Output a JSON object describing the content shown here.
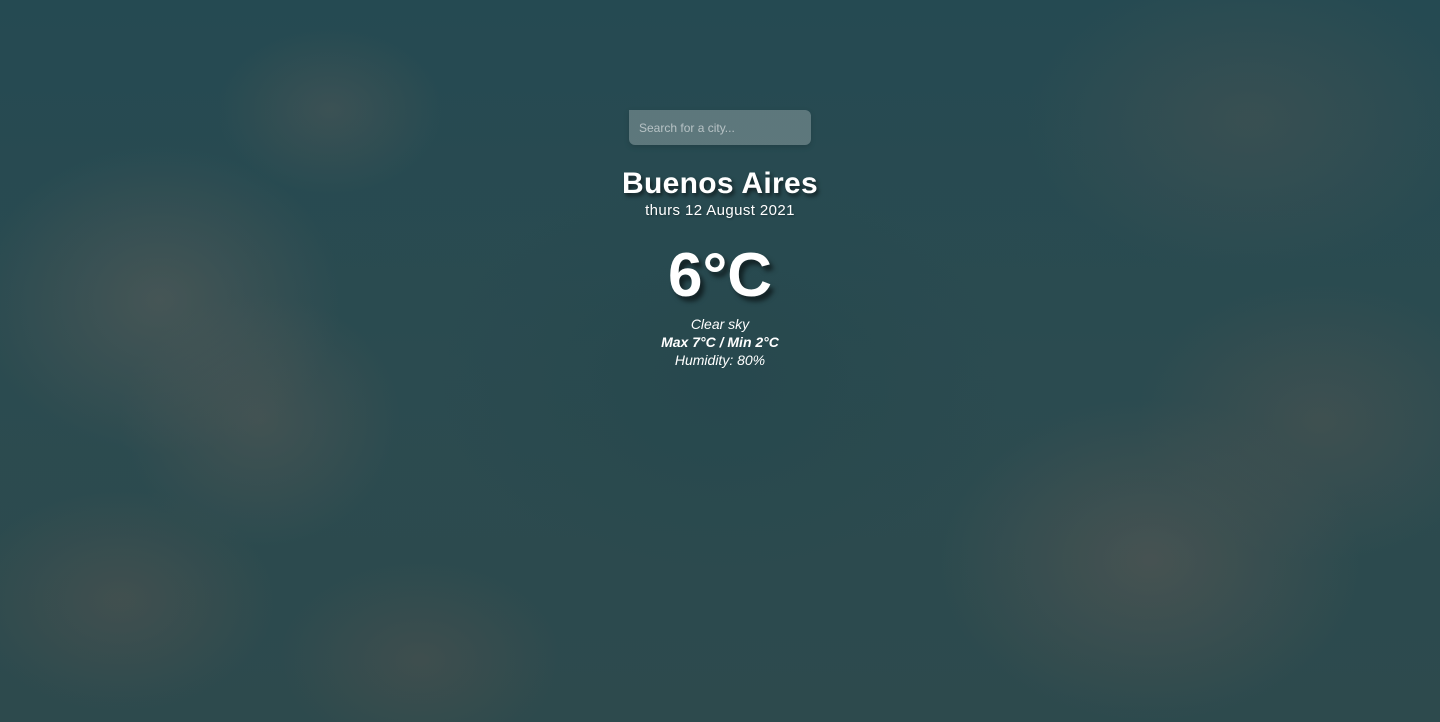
{
  "search": {
    "placeholder": "Search for a city..."
  },
  "weather": {
    "city": "Buenos Aires",
    "date": "thurs 12 August 2021",
    "temperature": "6°C",
    "description": "Clear sky",
    "max_min": "Max 7°C / Min 2°C",
    "humidity": "Humidity: 80%"
  },
  "colors": {
    "background": "#2a4a4f",
    "text": "#ffffff"
  }
}
